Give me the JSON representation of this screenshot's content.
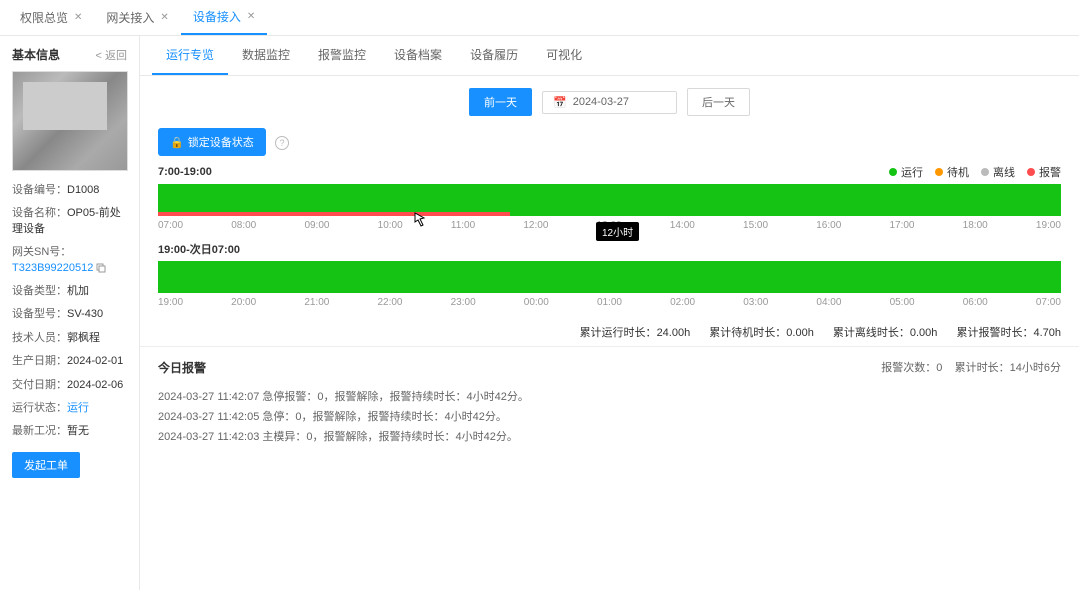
{
  "topTabs": [
    {
      "label": "权限总览",
      "active": false
    },
    {
      "label": "网关接入",
      "active": false
    },
    {
      "label": "设备接入",
      "active": true
    }
  ],
  "sidebar": {
    "title": "基本信息",
    "back": "< 返回",
    "rows": {
      "idLabel": "设备编号：",
      "idVal": "D1008",
      "nameLabel": "设备名称：",
      "nameVal": "OP05-前处理设备",
      "snLabel": "网关SN号：",
      "snVal": "T323B99220512",
      "typeLabel": "设备类型：",
      "typeVal": "机加",
      "modelLabel": "设备型号：",
      "modelVal": "SV-430",
      "techLabel": "技术人员：",
      "techVal": "郭枫程",
      "prodDateLabel": "生产日期：",
      "prodDateVal": "2024-02-01",
      "delivLabel": "交付日期：",
      "delivVal": "2024-02-06",
      "statusLabel": "运行状态：",
      "statusVal": "运行",
      "workorderLabel": "最新工况：",
      "workorderVal": "暂无"
    },
    "sendBtn": "发起工单"
  },
  "subTabs": [
    "运行专览",
    "数据监控",
    "报警监控",
    "设备档案",
    "设备履历",
    "可视化"
  ],
  "subTabActive": 0,
  "dateBar": {
    "prev": "前一天",
    "next": "后一天",
    "date": "2024-03-27"
  },
  "lockBtn": "锁定设备状态",
  "legend": {
    "run": {
      "label": "运行",
      "color": "#14c314"
    },
    "standby": {
      "label": "待机",
      "color": "#ff9800"
    },
    "offline": {
      "label": "离线",
      "color": "#bbbbbb"
    },
    "alarm": {
      "label": "报警",
      "color": "#ff4d4f"
    }
  },
  "timeline1": {
    "title": "7:00-19:00",
    "tooltip": "12小时",
    "ticks": [
      "07:00",
      "08:00",
      "09:00",
      "10:00",
      "11:00",
      "12:00",
      "13:00",
      "14:00",
      "15:00",
      "16:00",
      "17:00",
      "18:00",
      "19:00"
    ]
  },
  "timeline2": {
    "title": "19:00-次日07:00",
    "ticks": [
      "19:00",
      "20:00",
      "21:00",
      "22:00",
      "23:00",
      "00:00",
      "01:00",
      "02:00",
      "03:00",
      "04:00",
      "05:00",
      "06:00",
      "07:00"
    ]
  },
  "stats": {
    "runLabel": "累计运行时长：",
    "runVal": "24.00h",
    "standbyLabel": "累计待机时长：",
    "standbyVal": "0.00h",
    "offlineLabel": "累计离线时长：",
    "offlineVal": "0.00h",
    "alarmLabel": "累计报警时长：",
    "alarmVal": "4.70h"
  },
  "alarms": {
    "title": "今日报警",
    "countLabel": "报警次数：",
    "countVal": "0",
    "totalLabel": "累计时长：",
    "totalVal": "14小时6分",
    "items": [
      "2024-03-27 11:42:07 急停报警：0，报警解除，报警持续时长：4小时42分。",
      "2024-03-27 11:42:05 急停：0，报警解除，报警持续时长：4小时42分。",
      "2024-03-27 11:42:03 主模异：0，报警解除，报警持续时长：4小时42分。"
    ]
  },
  "chart_data": [
    {
      "type": "bar",
      "title": "7:00-19:00 设备状态时间轴",
      "x_range": [
        "07:00",
        "19:00"
      ],
      "segments": [
        {
          "state": "运行",
          "color": "#14c314",
          "start": "07:00",
          "end": "19:00"
        }
      ],
      "alarm_overlay": [
        {
          "start": "07:00",
          "end": "11:42"
        }
      ]
    },
    {
      "type": "bar",
      "title": "19:00-次日07:00 设备状态时间轴",
      "x_range": [
        "19:00",
        "07:00"
      ],
      "segments": [
        {
          "state": "运行",
          "color": "#14c314",
          "start": "19:00",
          "end": "07:00"
        }
      ],
      "alarm_overlay": []
    }
  ]
}
